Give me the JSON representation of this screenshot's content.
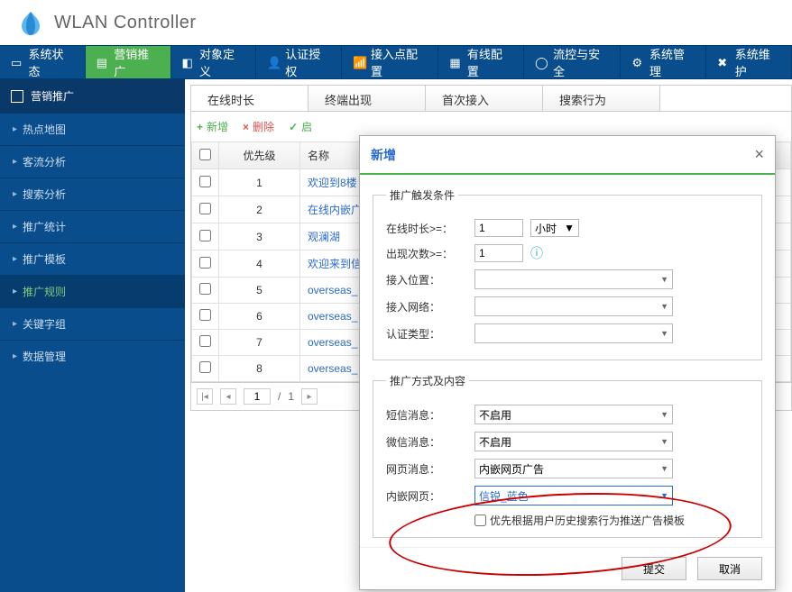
{
  "header": {
    "title": "WLAN Controller"
  },
  "topnav": [
    {
      "label": "系统状态"
    },
    {
      "label": "营销推广"
    },
    {
      "label": "对象定义"
    },
    {
      "label": "认证授权"
    },
    {
      "label": "接入点配置"
    },
    {
      "label": "有线配置"
    },
    {
      "label": "流控与安全"
    },
    {
      "label": "系统管理"
    },
    {
      "label": "系统维护"
    }
  ],
  "sidebar": {
    "header": "营销推广",
    "items": [
      {
        "label": "热点地图"
      },
      {
        "label": "客流分析"
      },
      {
        "label": "搜索分析"
      },
      {
        "label": "推广统计"
      },
      {
        "label": "推广模板"
      },
      {
        "label": "推广规则"
      },
      {
        "label": "关键字组"
      },
      {
        "label": "数据管理"
      }
    ]
  },
  "tabs": [
    {
      "label": "在线时长"
    },
    {
      "label": "终端出现"
    },
    {
      "label": "首次接入"
    },
    {
      "label": "搜索行为"
    }
  ],
  "toolbar": {
    "add": "新增",
    "del": "删除",
    "ena": "启"
  },
  "grid": {
    "cols": {
      "prio": "优先级",
      "name": "名称"
    },
    "rows": [
      {
        "prio": "1",
        "name": "欢迎到8楼"
      },
      {
        "prio": "2",
        "name": "在线内嵌广"
      },
      {
        "prio": "3",
        "name": "观澜湖"
      },
      {
        "prio": "4",
        "name": "欢迎来到信"
      },
      {
        "prio": "5",
        "name": "overseas_"
      },
      {
        "prio": "6",
        "name": "overseas_"
      },
      {
        "prio": "7",
        "name": "overseas_"
      },
      {
        "prio": "8",
        "name": "overseas_"
      }
    ]
  },
  "pager": {
    "page": "1",
    "total": "1"
  },
  "modal": {
    "title": "新增",
    "legend1": "推广触发条件",
    "legend2": "推广方式及内容",
    "online_label": "在线时长>=：",
    "online_value": "1",
    "online_unit": "小时",
    "count_label": "出现次数>=：",
    "count_value": "1",
    "pos_label": "接入位置：",
    "net_label": "接入网络：",
    "auth_label": "认证类型：",
    "sms_label": "短信消息：",
    "sms_value": "不启用",
    "wechat_label": "微信消息：",
    "wechat_value": "不启用",
    "web_label": "网页消息：",
    "web_value": "内嵌网页广告",
    "embed_label": "内嵌网页：",
    "embed_value": "信锐_蓝色",
    "chk_label": "优先根据用户历史搜索行为推送广告模板",
    "submit": "提交",
    "cancel": "取消"
  }
}
